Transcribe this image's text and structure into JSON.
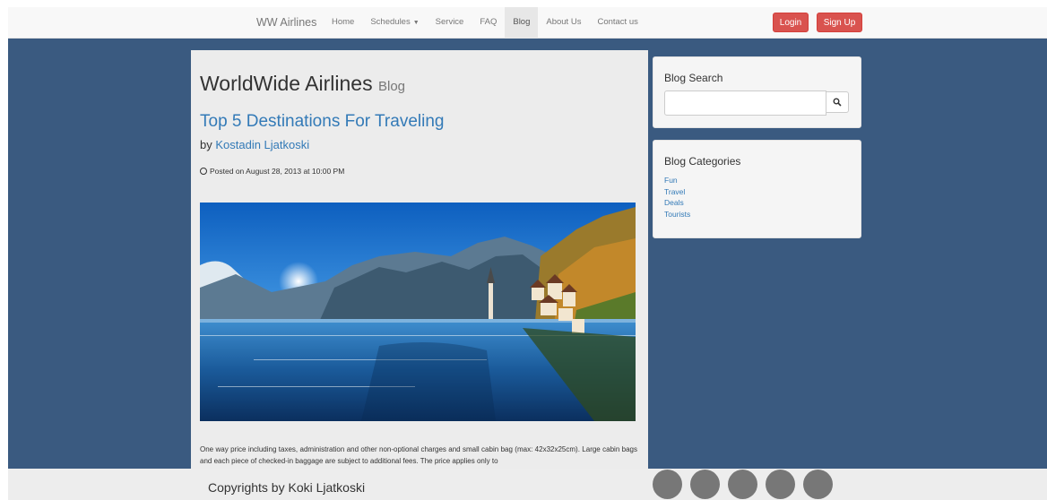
{
  "navbar": {
    "brand": "WW Airlines",
    "items": [
      {
        "label": "Home"
      },
      {
        "label": "Schedules",
        "dropdown": true
      },
      {
        "label": "Service"
      },
      {
        "label": "FAQ"
      },
      {
        "label": "Blog",
        "active": true
      },
      {
        "label": "About Us"
      },
      {
        "label": "Contact us"
      }
    ],
    "login_label": "Login",
    "signup_label": "Sign Up"
  },
  "blog": {
    "title": "WorldWide Airlines",
    "subtitle": "Blog"
  },
  "post": {
    "title": "Top 5 Destinations For Traveling",
    "by": "by",
    "author": "Kostadin Ljatkoski",
    "posted": "Posted on August 28, 2013 at 10:00 PM",
    "excerpt": "One way price including taxes, administration and other non-optional charges and small cabin bag (max: 42x32x25cm). Large cabin bags and each piece of checked-in baggage are subject to additional fees. The price applies only to"
  },
  "sidebar": {
    "search_title": "Blog Search",
    "search_value": "",
    "categories_title": "Blog Categories",
    "categories": [
      "Fun",
      "Travel",
      "Deals",
      "Tourists"
    ]
  },
  "footer": {
    "copyright": "Copyrights by Koki Ljatkoski",
    "social_count": 5
  },
  "colors": {
    "accent_blue": "#337ab7",
    "background_blue": "#3a5a80",
    "button_red": "#d9534f"
  },
  "icons": {
    "search": "search-icon",
    "clock": "clock-icon",
    "caret": "caret-down-icon"
  }
}
